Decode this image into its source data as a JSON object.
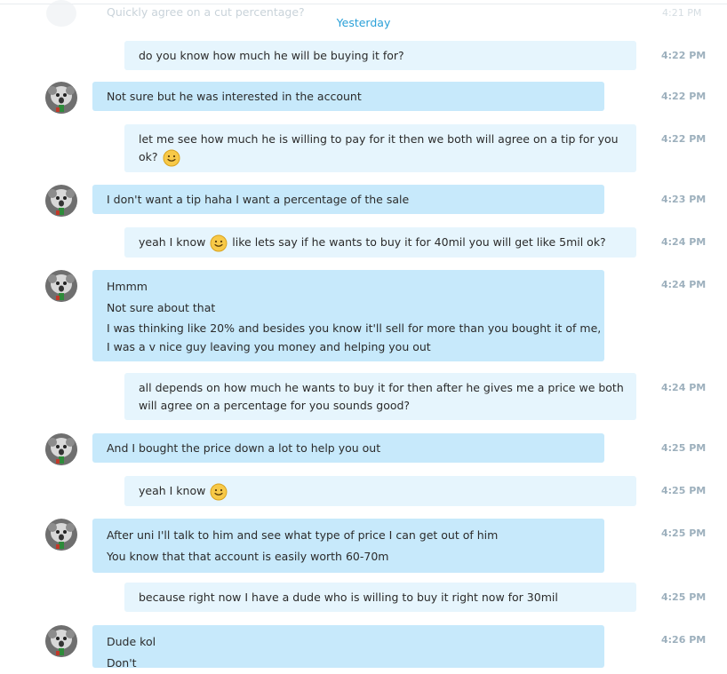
{
  "header": {
    "ghost_text": "Quickly agree on a cut percentage?",
    "ghost_time": "4:21 PM",
    "day_separator": "Yesterday"
  },
  "messages": [
    {
      "dir": "out",
      "time": "4:22 PM",
      "lines": [
        "do you know how much he will be buying it for?"
      ]
    },
    {
      "dir": "in",
      "time": "4:22 PM",
      "lines": [
        "Not sure but he was interested in the account"
      ]
    },
    {
      "dir": "out",
      "time": "4:22 PM",
      "lines": [
        "let me see how much he is willing to pay for it then we both will agree on a tip for you",
        "ok? {smile}"
      ]
    },
    {
      "dir": "in",
      "time": "4:23 PM",
      "lines": [
        "I don't want a tip haha I want a percentage of the sale"
      ]
    },
    {
      "dir": "out",
      "time": "4:24 PM",
      "lines": [
        "yeah I know {smile} like lets say if he wants to buy it for 40mil you will get like 5mil ok?"
      ]
    },
    {
      "dir": "in",
      "time": "4:24 PM",
      "lines": [
        "Hmmm",
        "Not sure about that",
        "I was thinking like 20% and besides you know it'll sell for more than you bought it of me,",
        "I was a v nice guy leaving you money and helping you out"
      ]
    },
    {
      "dir": "out",
      "time": "4:24 PM",
      "lines": [
        "all depends on how much he wants to buy it for then after he gives me a price we both",
        "will agree on a percentage for you sounds good?"
      ]
    },
    {
      "dir": "in",
      "time": "4:25 PM",
      "lines": [
        "And I bought the price down a lot to help you out"
      ]
    },
    {
      "dir": "out",
      "time": "4:25 PM",
      "lines": [
        "yeah I know {smile}"
      ]
    },
    {
      "dir": "in",
      "time": "4:25 PM",
      "lines": [
        "After uni I'll talk to him and see what type of price I can get out of him",
        "You know that that account is easily worth 60-70m"
      ]
    },
    {
      "dir": "out",
      "time": "4:25 PM",
      "lines": [
        "because right now I have a dude who is willing to buy it right now for 30mil"
      ]
    },
    {
      "dir": "in",
      "time": "4:26 PM",
      "lines": [
        "Dude kol",
        "Don't"
      ]
    }
  ],
  "colors": {
    "incoming_bubble": "#c7e9fb",
    "outgoing_bubble": "#e6f5fd",
    "timestamp": "#9db0bd",
    "separator": "#2aa0d8"
  },
  "icons": {
    "emoji": "smile-emoji-icon",
    "avatar": "contact-avatar"
  }
}
